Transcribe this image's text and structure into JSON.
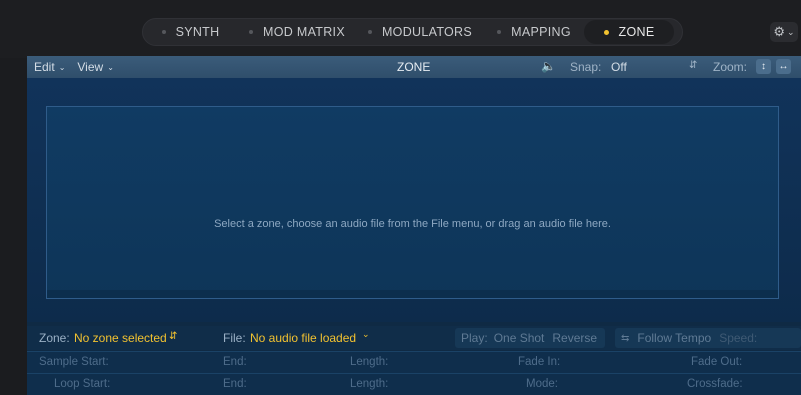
{
  "tabs": [
    {
      "label": "SYNTH",
      "active": false
    },
    {
      "label": "MOD MATRIX",
      "active": false
    },
    {
      "label": "MODULATORS",
      "active": false
    },
    {
      "label": "MAPPING",
      "active": false
    },
    {
      "label": "ZONE",
      "active": true
    }
  ],
  "colors": {
    "accent": "#f2c230",
    "panel": "#0f2a44"
  },
  "toolbar": {
    "edit_label": "Edit",
    "view_label": "View",
    "title": "ZONE",
    "snap_label": "Snap:",
    "snap_value": "Off",
    "zoom_label": "Zoom:",
    "icons": [
      "speaker-icon",
      "zoom-vertical-icon",
      "zoom-horizontal-icon",
      "gear-icon"
    ]
  },
  "dropzone": {
    "hint": "Select a zone, choose an audio file from the File menu, or drag an audio file here."
  },
  "info": {
    "zone_label": "Zone:",
    "zone_value": "No zone selected",
    "file_label": "File:",
    "file_value": "No audio file loaded",
    "play_label": "Play:",
    "one_shot": "One Shot",
    "reverse": "Reverse",
    "follow_tempo": "Follow Tempo",
    "speed_label": "Speed:"
  },
  "fields": {
    "row1": {
      "sample_start": "Sample Start:",
      "end": "End:",
      "length": "Length:",
      "fade_in": "Fade In:",
      "fade_out": "Fade Out:"
    },
    "row2": {
      "loop_start": "Loop Start:",
      "end": "End:",
      "length": "Length:",
      "mode": "Mode:",
      "crossfade": "Crossfade:"
    }
  }
}
